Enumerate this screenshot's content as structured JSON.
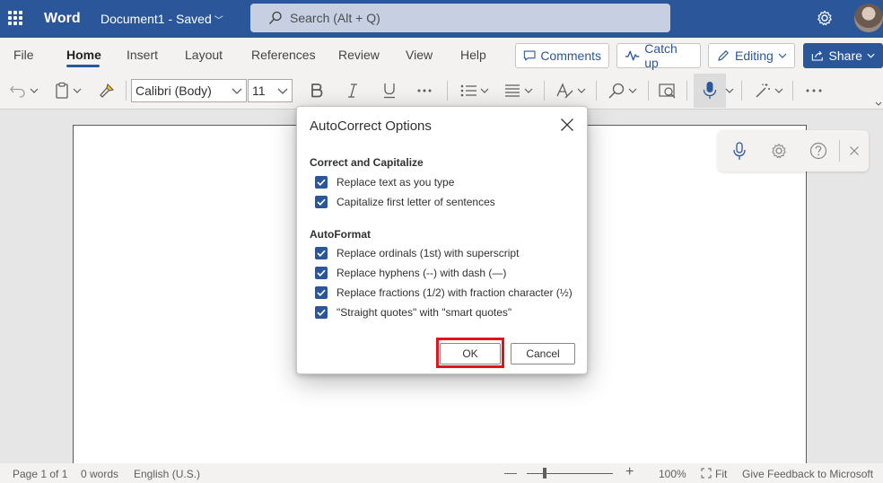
{
  "titlebar": {
    "app_name": "Word",
    "doc_name": "Document1 - Saved",
    "search_placeholder": "Search (Alt + Q)"
  },
  "ribbon_tabs": [
    "File",
    "Home",
    "Insert",
    "Layout",
    "References",
    "Review",
    "View",
    "Help"
  ],
  "ribbon_buttons": {
    "comments": "Comments",
    "catch_up": "Catch up",
    "editing": "Editing",
    "share": "Share"
  },
  "toolbar": {
    "font_name": "Calibri (Body)",
    "font_size": "11"
  },
  "dialog": {
    "title": "AutoCorrect Options",
    "sections": [
      {
        "heading": "Correct and Capitalize",
        "options": [
          {
            "label": "Replace text as you type",
            "checked": true
          },
          {
            "label": "Capitalize first letter of sentences",
            "checked": true
          }
        ]
      },
      {
        "heading": "AutoFormat",
        "options": [
          {
            "label": "Replace ordinals (1st) with superscript",
            "checked": true
          },
          {
            "label": "Replace hyphens (--) with dash (—)",
            "checked": true
          },
          {
            "label": "Replace fractions (1/2) with fraction character (½)",
            "checked": true
          },
          {
            "label": "\"Straight quotes\" with \"smart quotes\"",
            "checked": true
          }
        ]
      }
    ],
    "ok_label": "OK",
    "cancel_label": "Cancel"
  },
  "statusbar": {
    "page": "Page 1 of 1",
    "words": "0 words",
    "language": "English (U.S.)",
    "zoom_minus": "—",
    "zoom_plus": "+",
    "zoom": "100%",
    "fit": "Fit",
    "feedback": "Give Feedback to Microsoft"
  },
  "colors": {
    "brand": "#2b579a",
    "highlight_ring": "#e0141e"
  },
  "icons": [
    "waffle-icon",
    "search-icon",
    "settings-icon",
    "undo-icon",
    "paste-icon",
    "format-painter-icon",
    "bold-icon",
    "italic-icon",
    "underline-icon",
    "bullets-icon",
    "align-icon",
    "styles-icon",
    "find-icon",
    "designer-icon",
    "dictate-icon",
    "editor-icon",
    "more-icon",
    "close-icon",
    "help-icon"
  ]
}
